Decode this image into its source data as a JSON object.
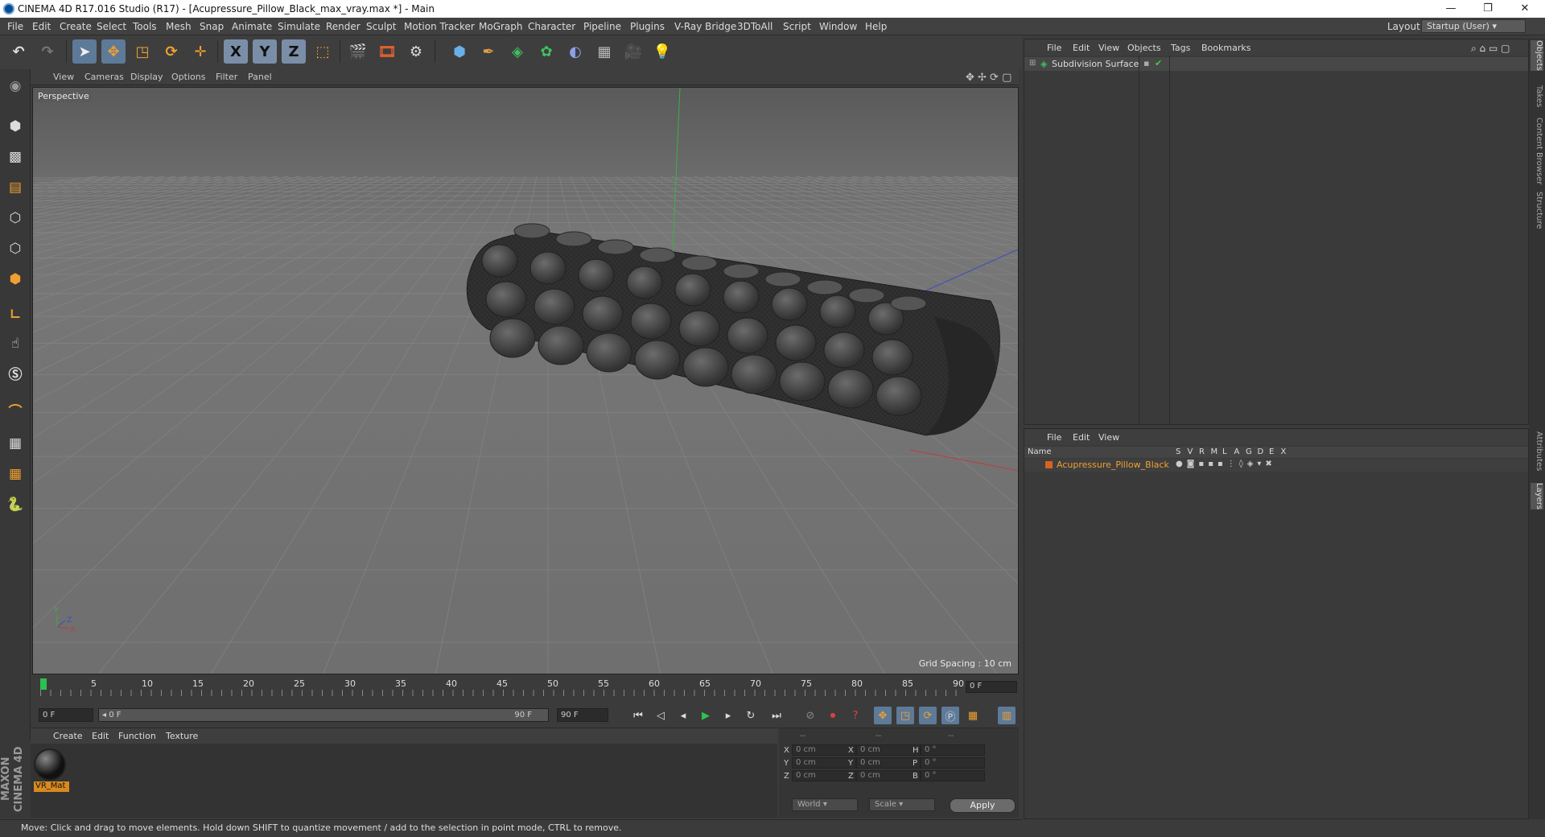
{
  "window": {
    "title": "CINEMA 4D R17.016 Studio (R17) - [Acupressure_Pillow_Black_max_vray.max *] - Main",
    "minimize": "—",
    "restore": "❐",
    "close": "✕"
  },
  "menubar": {
    "items": [
      "File",
      "Edit",
      "Create",
      "Select",
      "Tools",
      "Mesh",
      "Snap",
      "Animate",
      "Simulate",
      "Render",
      "Sculpt",
      "Motion Tracker",
      "MoGraph",
      "Character",
      "Pipeline",
      "Plugins",
      "V-Ray Bridge",
      "3DToAll",
      "Script",
      "Window",
      "Help"
    ],
    "layout_label": "Layout:",
    "layout_value": "Startup (User)"
  },
  "toolbar": {
    "icons": [
      "undo-icon",
      "redo-icon",
      "select-arrow-icon",
      "move-icon",
      "scale-icon",
      "rotate-icon",
      "move-cross-icon",
      "x-axis-icon",
      "y-axis-icon",
      "z-axis-icon",
      "coord-system-icon",
      "render-view-icon",
      "render-picture-viewer-icon",
      "render-settings-icon",
      "cube-icon",
      "pen-icon",
      "subdivision-icon",
      "mograph-cloner-icon",
      "deformer-icon",
      "floor-icon",
      "camera-icon",
      "light-icon"
    ],
    "axis_x": "X",
    "axis_y": "Y",
    "axis_z": "Z"
  },
  "viewport": {
    "menu": [
      "View",
      "Cameras",
      "Display",
      "Options",
      "Filter",
      "Panel"
    ],
    "label": "Perspective",
    "grid_spacing": "Grid Spacing : 10 cm"
  },
  "timeline": {
    "ticks": [
      "0",
      "5",
      "10",
      "15",
      "20",
      "25",
      "30",
      "35",
      "40",
      "45",
      "50",
      "55",
      "60",
      "65",
      "70",
      "75",
      "80",
      "85",
      "90"
    ],
    "current_frame": "0 F",
    "start_field": "0 F",
    "range_start": "0 F",
    "range_end": "90 F",
    "end_field": "90 F"
  },
  "material_panel": {
    "menu": [
      "Create",
      "Edit",
      "Function",
      "Texture"
    ],
    "material_name": "VR_Mat"
  },
  "coordinates": {
    "header": [
      "--",
      "--",
      "--"
    ],
    "rows": [
      {
        "a": "X",
        "av": "0 cm",
        "b": "X",
        "bv": "0 cm",
        "c": "H",
        "cv": "0 °"
      },
      {
        "a": "Y",
        "av": "0 cm",
        "b": "Y",
        "bv": "0 cm",
        "c": "P",
        "cv": "0 °"
      },
      {
        "a": "Z",
        "av": "0 cm",
        "b": "Z",
        "bv": "0 cm",
        "c": "B",
        "cv": "0 °"
      }
    ],
    "mode_world": "World",
    "mode_scale": "Scale",
    "apply": "Apply"
  },
  "object_manager": {
    "menu": [
      "File",
      "Edit",
      "View",
      "Objects",
      "Tags",
      "Bookmarks"
    ],
    "object_name": "Subdivision Surface"
  },
  "layer_manager": {
    "menu": [
      "File",
      "Edit",
      "View"
    ],
    "col_name": "Name",
    "cols": [
      "S",
      "V",
      "R",
      "M",
      "L",
      "A",
      "G",
      "D",
      "E",
      "X"
    ],
    "layer_name": "Acupressure_Pillow_Black",
    "layer_color": "#d8631e"
  },
  "right_tabs": [
    "Objects",
    "Takes",
    "Content Browser",
    "Structure",
    "Attributes",
    "Layers"
  ],
  "maxon_logo": "MAXON CINEMA 4D",
  "status_text": "Move: Click and drag to move elements. Hold down SHIFT to quantize movement / add to the selection in point mode, CTRL to remove."
}
